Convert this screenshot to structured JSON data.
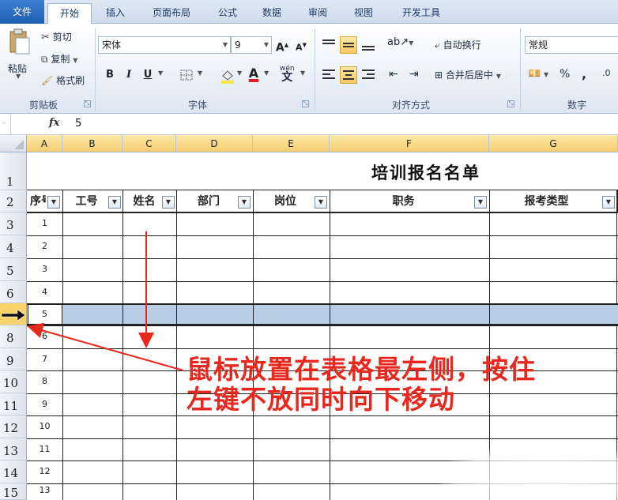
{
  "tabs": [
    "文件",
    "开始",
    "插入",
    "页面布局",
    "公式",
    "数据",
    "审阅",
    "视图",
    "开发工具"
  ],
  "active_tab": "开始",
  "clipboard": {
    "paste": "粘贴",
    "cut": "剪切",
    "copy": "复制",
    "format_painter": "格式刷",
    "label": "剪贴板"
  },
  "font": {
    "name": "宋体",
    "size": "9",
    "bold": "B",
    "italic": "I",
    "underline": "U",
    "label": "字体",
    "grow": "A",
    "shrink": "A",
    "font_color_glyph": "A",
    "phonetic": "wén"
  },
  "alignment": {
    "wrap": "自动换行",
    "merge": "合并后居中",
    "label": "对齐方式"
  },
  "number": {
    "format": "常规",
    "percent": "%",
    "comma": ",",
    "label": "数字"
  },
  "formula_bar": {
    "fx": "fx",
    "value": "5"
  },
  "columns": [
    "A",
    "B",
    "C",
    "D",
    "E",
    "F",
    "G"
  ],
  "rows": [
    "1",
    "2",
    "3",
    "4",
    "5",
    "6",
    "",
    "8",
    "9",
    "10",
    "11",
    "12",
    "13",
    "14",
    "15"
  ],
  "sheet_title": "培训报名名单",
  "table_headers": [
    "序号",
    "工号",
    "姓名",
    "部门",
    "岗位",
    "职务",
    "报考类型"
  ],
  "row_numbers": [
    "1",
    "2",
    "3",
    "4",
    "5",
    "6",
    "7",
    "8",
    "9",
    "10",
    "11",
    "12",
    "13"
  ],
  "annotation": {
    "line1": "鼠标放置在表格最左侧，按住",
    "line2": "左键不放同时向下移动"
  },
  "colors": {
    "accent": "#1f5fb1",
    "annotation": "#e8281e",
    "selected_row": "#b8cce4"
  }
}
